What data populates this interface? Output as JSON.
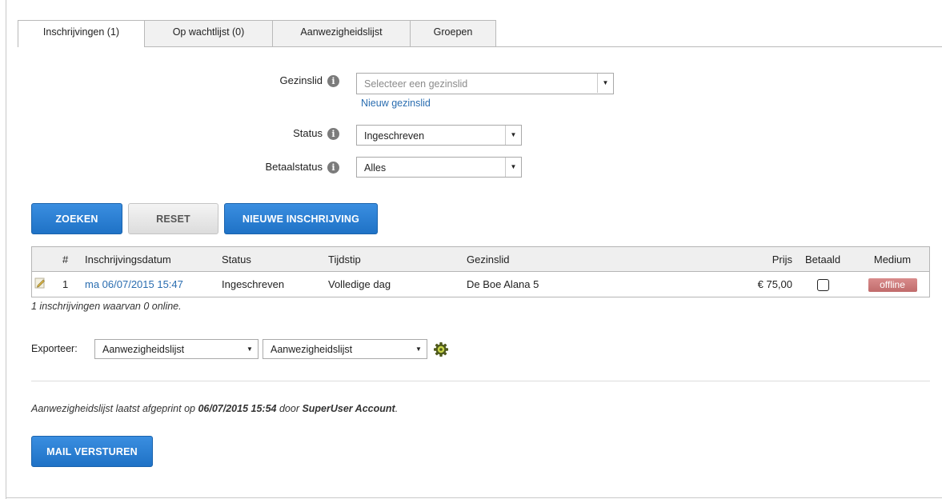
{
  "tabs": [
    {
      "label": "Inschrijvingen (1)",
      "active": true
    },
    {
      "label": "Op wachtlijst (0)",
      "active": false
    },
    {
      "label": "Aanwezigheidslijst",
      "active": false
    },
    {
      "label": "Groepen",
      "active": false
    }
  ],
  "form": {
    "gezinslid": {
      "label": "Gezinslid",
      "placeholder": "Selecteer een gezinslid",
      "new_link": "Nieuw gezinslid"
    },
    "status": {
      "label": "Status",
      "value": "Ingeschreven"
    },
    "betaalstatus": {
      "label": "Betaalstatus",
      "value": "Alles"
    }
  },
  "buttons": {
    "search": "ZOEKEN",
    "reset": "RESET",
    "new": "NIEUWE INSCHRIJVING",
    "mail": "MAIL VERSTUREN"
  },
  "table": {
    "headers": {
      "num": "#",
      "date": "Inschrijvingsdatum",
      "status": "Status",
      "tijdstip": "Tijdstip",
      "gezinslid": "Gezinslid",
      "prijs": "Prijs",
      "betaald": "Betaald",
      "medium": "Medium"
    },
    "rows": [
      {
        "num": "1",
        "date": "ma 06/07/2015 15:47",
        "status": "Ingeschreven",
        "tijdstip": "Volledige dag",
        "gezinslid": "De Boe Alana 5",
        "prijs": "€ 75,00",
        "betaald": false,
        "medium": "offline"
      }
    ]
  },
  "summary": "1 inschrijvingen waarvan 0 online.",
  "export": {
    "label": "Exporteer:",
    "select1": "Aanwezigheidslijst",
    "select2": "Aanwezigheidslijst"
  },
  "printed": {
    "prefix": "Aanwezigheidslijst laatst afgeprint op ",
    "datetime": "06/07/2015 15:54",
    "middle": " door ",
    "user": "SuperUser Account",
    "suffix": "."
  },
  "colors": {
    "primary": "#2478cc",
    "link": "#2a6db0",
    "badge": "#c87575"
  }
}
